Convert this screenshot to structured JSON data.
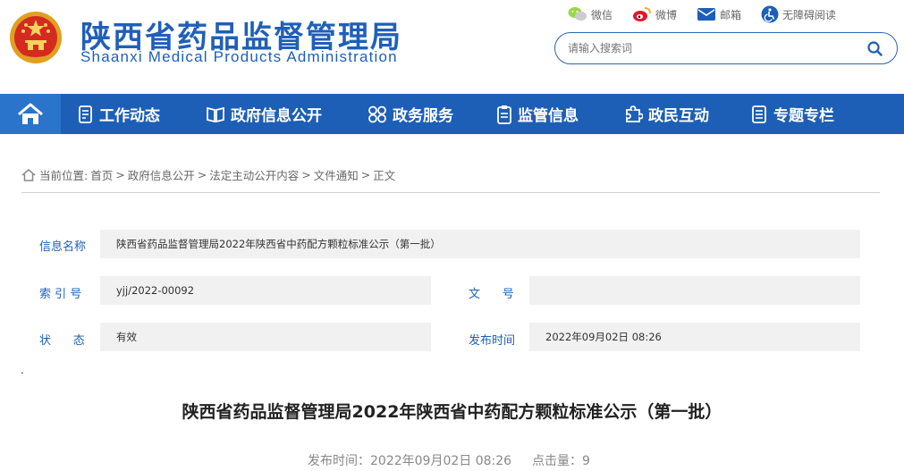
{
  "header": {
    "logo_cn": "陕西省药品监督管理局",
    "logo_en": "Shaanxi Medical Products Administration",
    "toplinks": [
      {
        "label": "微信",
        "icon": "wechat-icon"
      },
      {
        "label": "微博",
        "icon": "weibo-icon"
      },
      {
        "label": "邮箱",
        "icon": "mail-icon"
      },
      {
        "label": "无障碍阅读",
        "icon": "accessibility-icon"
      }
    ],
    "search": {
      "placeholder": "请输入搜索词"
    }
  },
  "nav": {
    "home_icon": "home-icon",
    "items": [
      {
        "label": "工作动态",
        "icon": "document-icon"
      },
      {
        "label": "政府信息公开",
        "icon": "book-icon"
      },
      {
        "label": "政务服务",
        "icon": "grid-icon"
      },
      {
        "label": "监管信息",
        "icon": "clipboard-icon"
      },
      {
        "label": "政民互动",
        "icon": "puzzle-icon"
      },
      {
        "label": "专题专栏",
        "icon": "folder-icon"
      }
    ]
  },
  "breadcrumb": {
    "prefix": "当前位置:",
    "items": [
      "首页",
      "政府信息公开",
      "法定主动公开内容",
      "文件通知",
      "正文"
    ],
    "separator": ">"
  },
  "info": {
    "name_label": "信息名称",
    "name_value": "陕西省药品监督管理局2022年陕西省中药配方颗粒标准公示（第一批）",
    "index_label": "索 引 号",
    "index_value": "yjj/2022-00092",
    "docno_label": "文      号",
    "docno_value": "",
    "status_label": "状      态",
    "status_value": "有效",
    "date_label": "发布时间",
    "date_value": "2022年09月02日 08:26"
  },
  "stray_dot": ".",
  "article": {
    "title": "陕西省药品监督管理局2022年陕西省中药配方颗粒标准公示（第一批）",
    "publish_label": "发布时间：",
    "publish_time": "2022年09月02日 08:26",
    "clicks_label": "点击量：",
    "clicks": "9"
  },
  "colors": {
    "brand": "#1d5fb6",
    "nav_home": "#2a74cc",
    "panel": "#f1f1f1"
  }
}
